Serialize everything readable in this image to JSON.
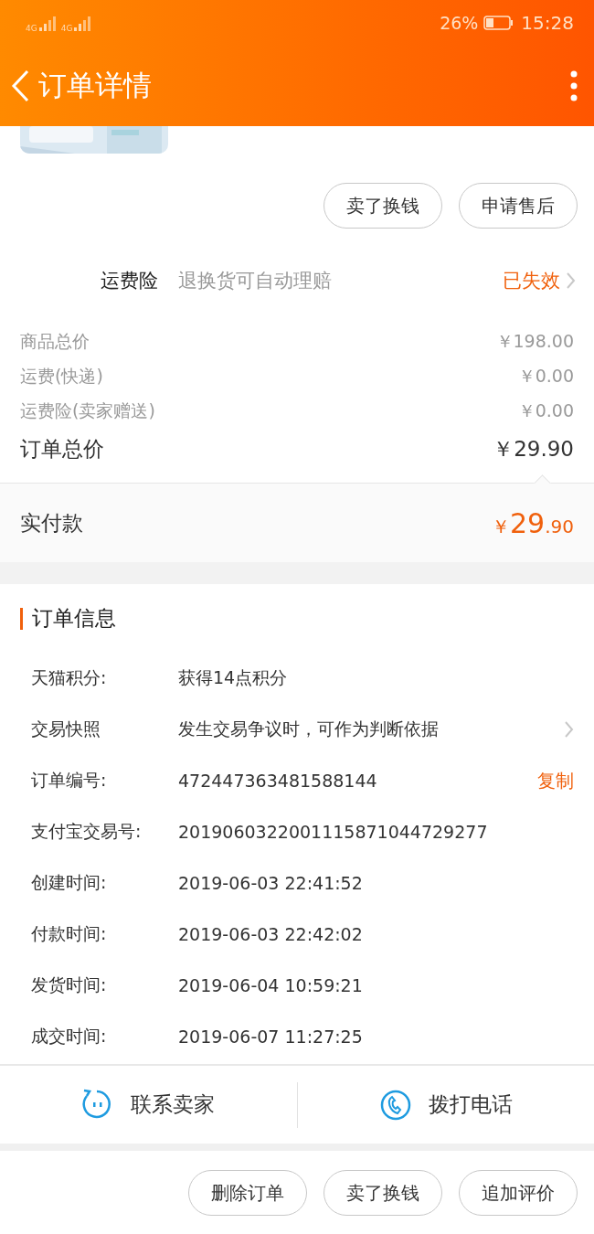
{
  "status_bar": {
    "networks": [
      "4G",
      "4G"
    ],
    "battery": "26%",
    "time": "15:28"
  },
  "header": {
    "title": "订单详情"
  },
  "product_actions": [
    "卖了换钱",
    "申请售后"
  ],
  "insurance": {
    "label": "运费险",
    "description": "退换货可自动理赔",
    "status": "已失效"
  },
  "price_rows": [
    {
      "kind": "minor",
      "label": "商品总价",
      "value": "￥198.00"
    },
    {
      "kind": "minor",
      "label": "运费(快递)",
      "value": "￥0.00"
    },
    {
      "kind": "minor",
      "label": "运费险(卖家赠送)",
      "value": "￥0.00"
    },
    {
      "kind": "total",
      "label": "订单总价",
      "value": "￥29.90"
    }
  ],
  "paid": {
    "label": "实付款",
    "currency": "￥",
    "integer": "29",
    "fraction": ".90"
  },
  "order_info": {
    "title": "订单信息",
    "rows": [
      {
        "kind": "plain",
        "label": "天猫积分:",
        "value": "获得14点积分"
      },
      {
        "kind": "link",
        "label": "交易快照",
        "value": "发生交易争议时，可作为判断依据"
      },
      {
        "kind": "action",
        "label": "订单编号:",
        "value": "472447363481588144",
        "action": "复制"
      },
      {
        "kind": "plain",
        "label": "支付宝交易号:",
        "value": "2019060322001115871044729277"
      },
      {
        "kind": "plain",
        "label": "创建时间:",
        "value": "2019-06-03 22:41:52"
      },
      {
        "kind": "plain",
        "label": "付款时间:",
        "value": "2019-06-03 22:42:02"
      },
      {
        "kind": "plain",
        "label": "发货时间:",
        "value": "2019-06-04 10:59:21"
      },
      {
        "kind": "plain",
        "label": "成交时间:",
        "value": "2019-06-07 11:27:25"
      }
    ]
  },
  "contact": [
    {
      "kind": "chat",
      "label": "联系卖家"
    },
    {
      "kind": "phone",
      "label": "拨打电话"
    }
  ],
  "bottom_actions": [
    "删除订单",
    "卖了换钱",
    "追加评价"
  ]
}
